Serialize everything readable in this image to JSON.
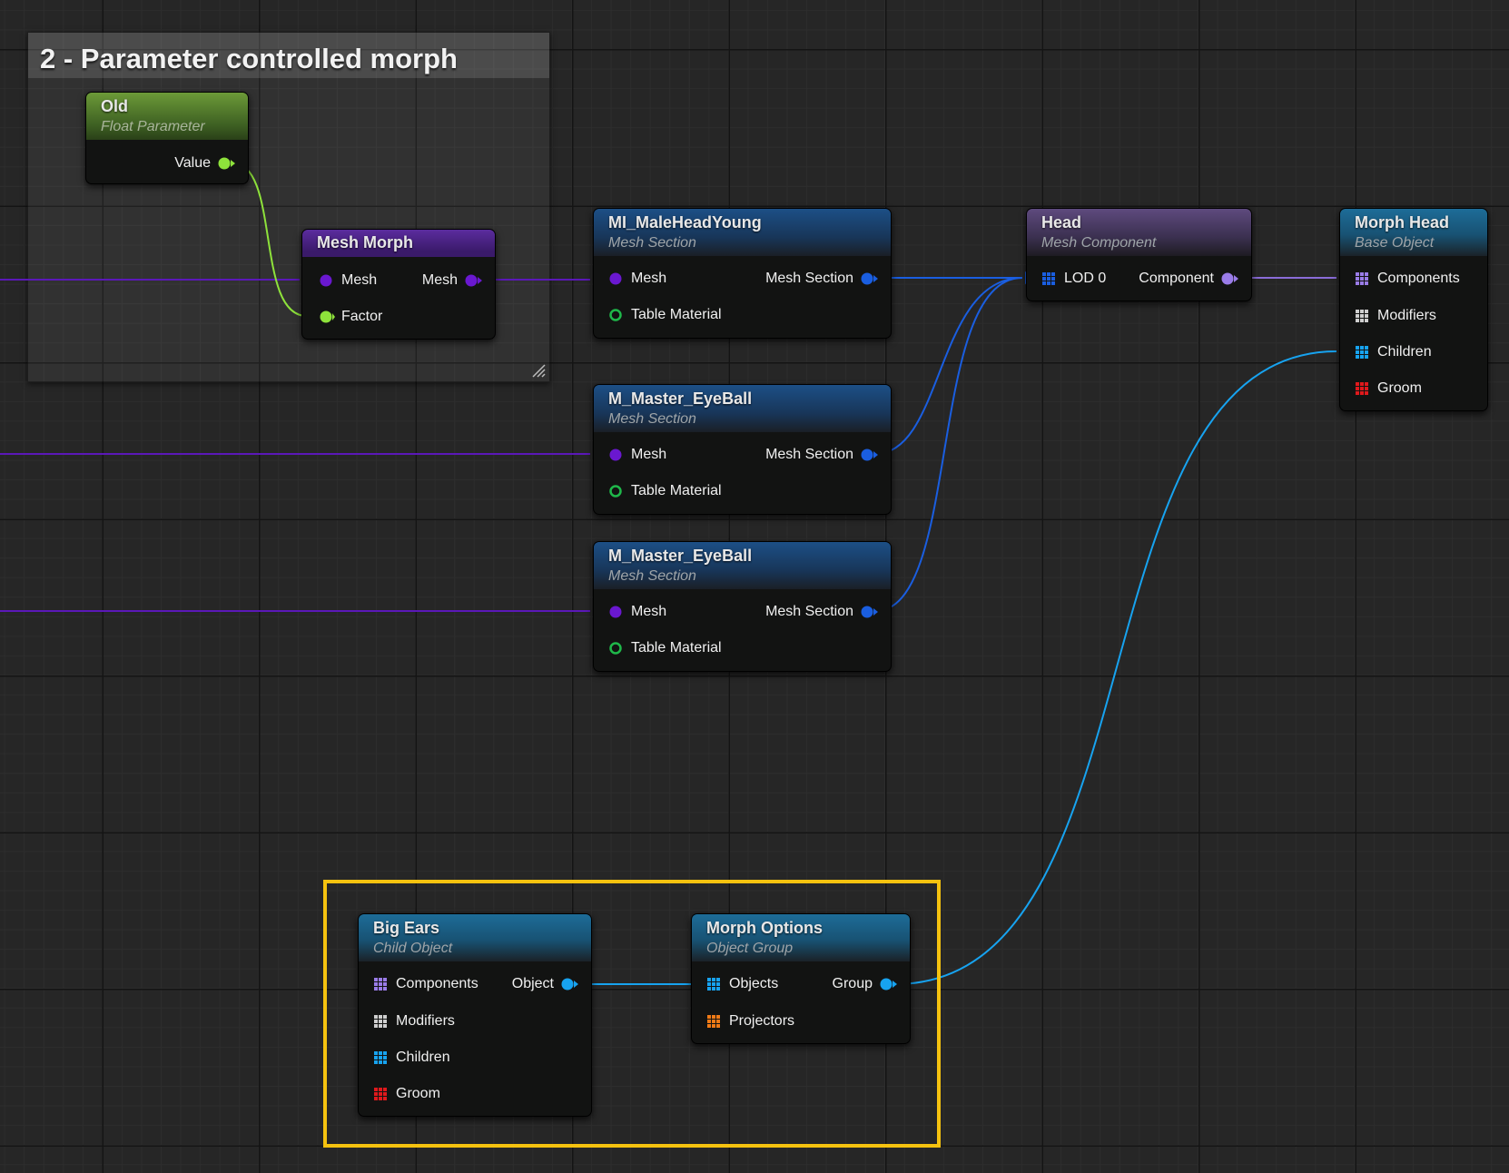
{
  "comment": {
    "title": "2 - Parameter controlled morph"
  },
  "nodes": {
    "old": {
      "title": "Old",
      "subtitle": "Float Parameter",
      "value_label": "Value"
    },
    "mesh_morph": {
      "title": "Mesh Morph",
      "mesh_in": "Mesh",
      "factor_in": "Factor",
      "mesh_out": "Mesh"
    },
    "mi_male_head_young": {
      "title": "MI_MaleHeadYoung",
      "subtitle": "Mesh Section",
      "mesh_in": "Mesh",
      "table_material": "Table Material",
      "out": "Mesh Section"
    },
    "m_master_eyeball_1": {
      "title": "M_Master_EyeBall",
      "subtitle": "Mesh Section",
      "mesh_in": "Mesh",
      "table_material": "Table Material",
      "out": "Mesh Section"
    },
    "m_master_eyeball_2": {
      "title": "M_Master_EyeBall",
      "subtitle": "Mesh Section",
      "mesh_in": "Mesh",
      "table_material": "Table Material",
      "out": "Mesh Section"
    },
    "head": {
      "title": "Head",
      "subtitle": "Mesh Component",
      "lod": "LOD 0",
      "out": "Component"
    },
    "morph_head": {
      "title": "Morph Head",
      "subtitle": "Base Object",
      "components": "Components",
      "modifiers": "Modifiers",
      "children": "Children",
      "groom": "Groom"
    },
    "big_ears": {
      "title": "Big Ears",
      "subtitle": "Child Object",
      "components": "Components",
      "modifiers": "Modifiers",
      "children": "Children",
      "groom": "Groom",
      "out": "Object"
    },
    "morph_options": {
      "title": "Morph Options",
      "subtitle": "Object Group",
      "objects": "Objects",
      "projectors": "Projectors",
      "out": "Group"
    }
  },
  "colors": {
    "float_pin": "#8ee23b",
    "mesh_pin": "#6a18d0",
    "mesh_section_pin": "#1a5ee0",
    "component_pin": "#9a7ce8",
    "object_pin": "#17a3f0",
    "material_pin": "#1fb84a",
    "groom_pin": "#e0191c",
    "projector_pin": "#f07a16",
    "highlight": "#f5c20f"
  }
}
